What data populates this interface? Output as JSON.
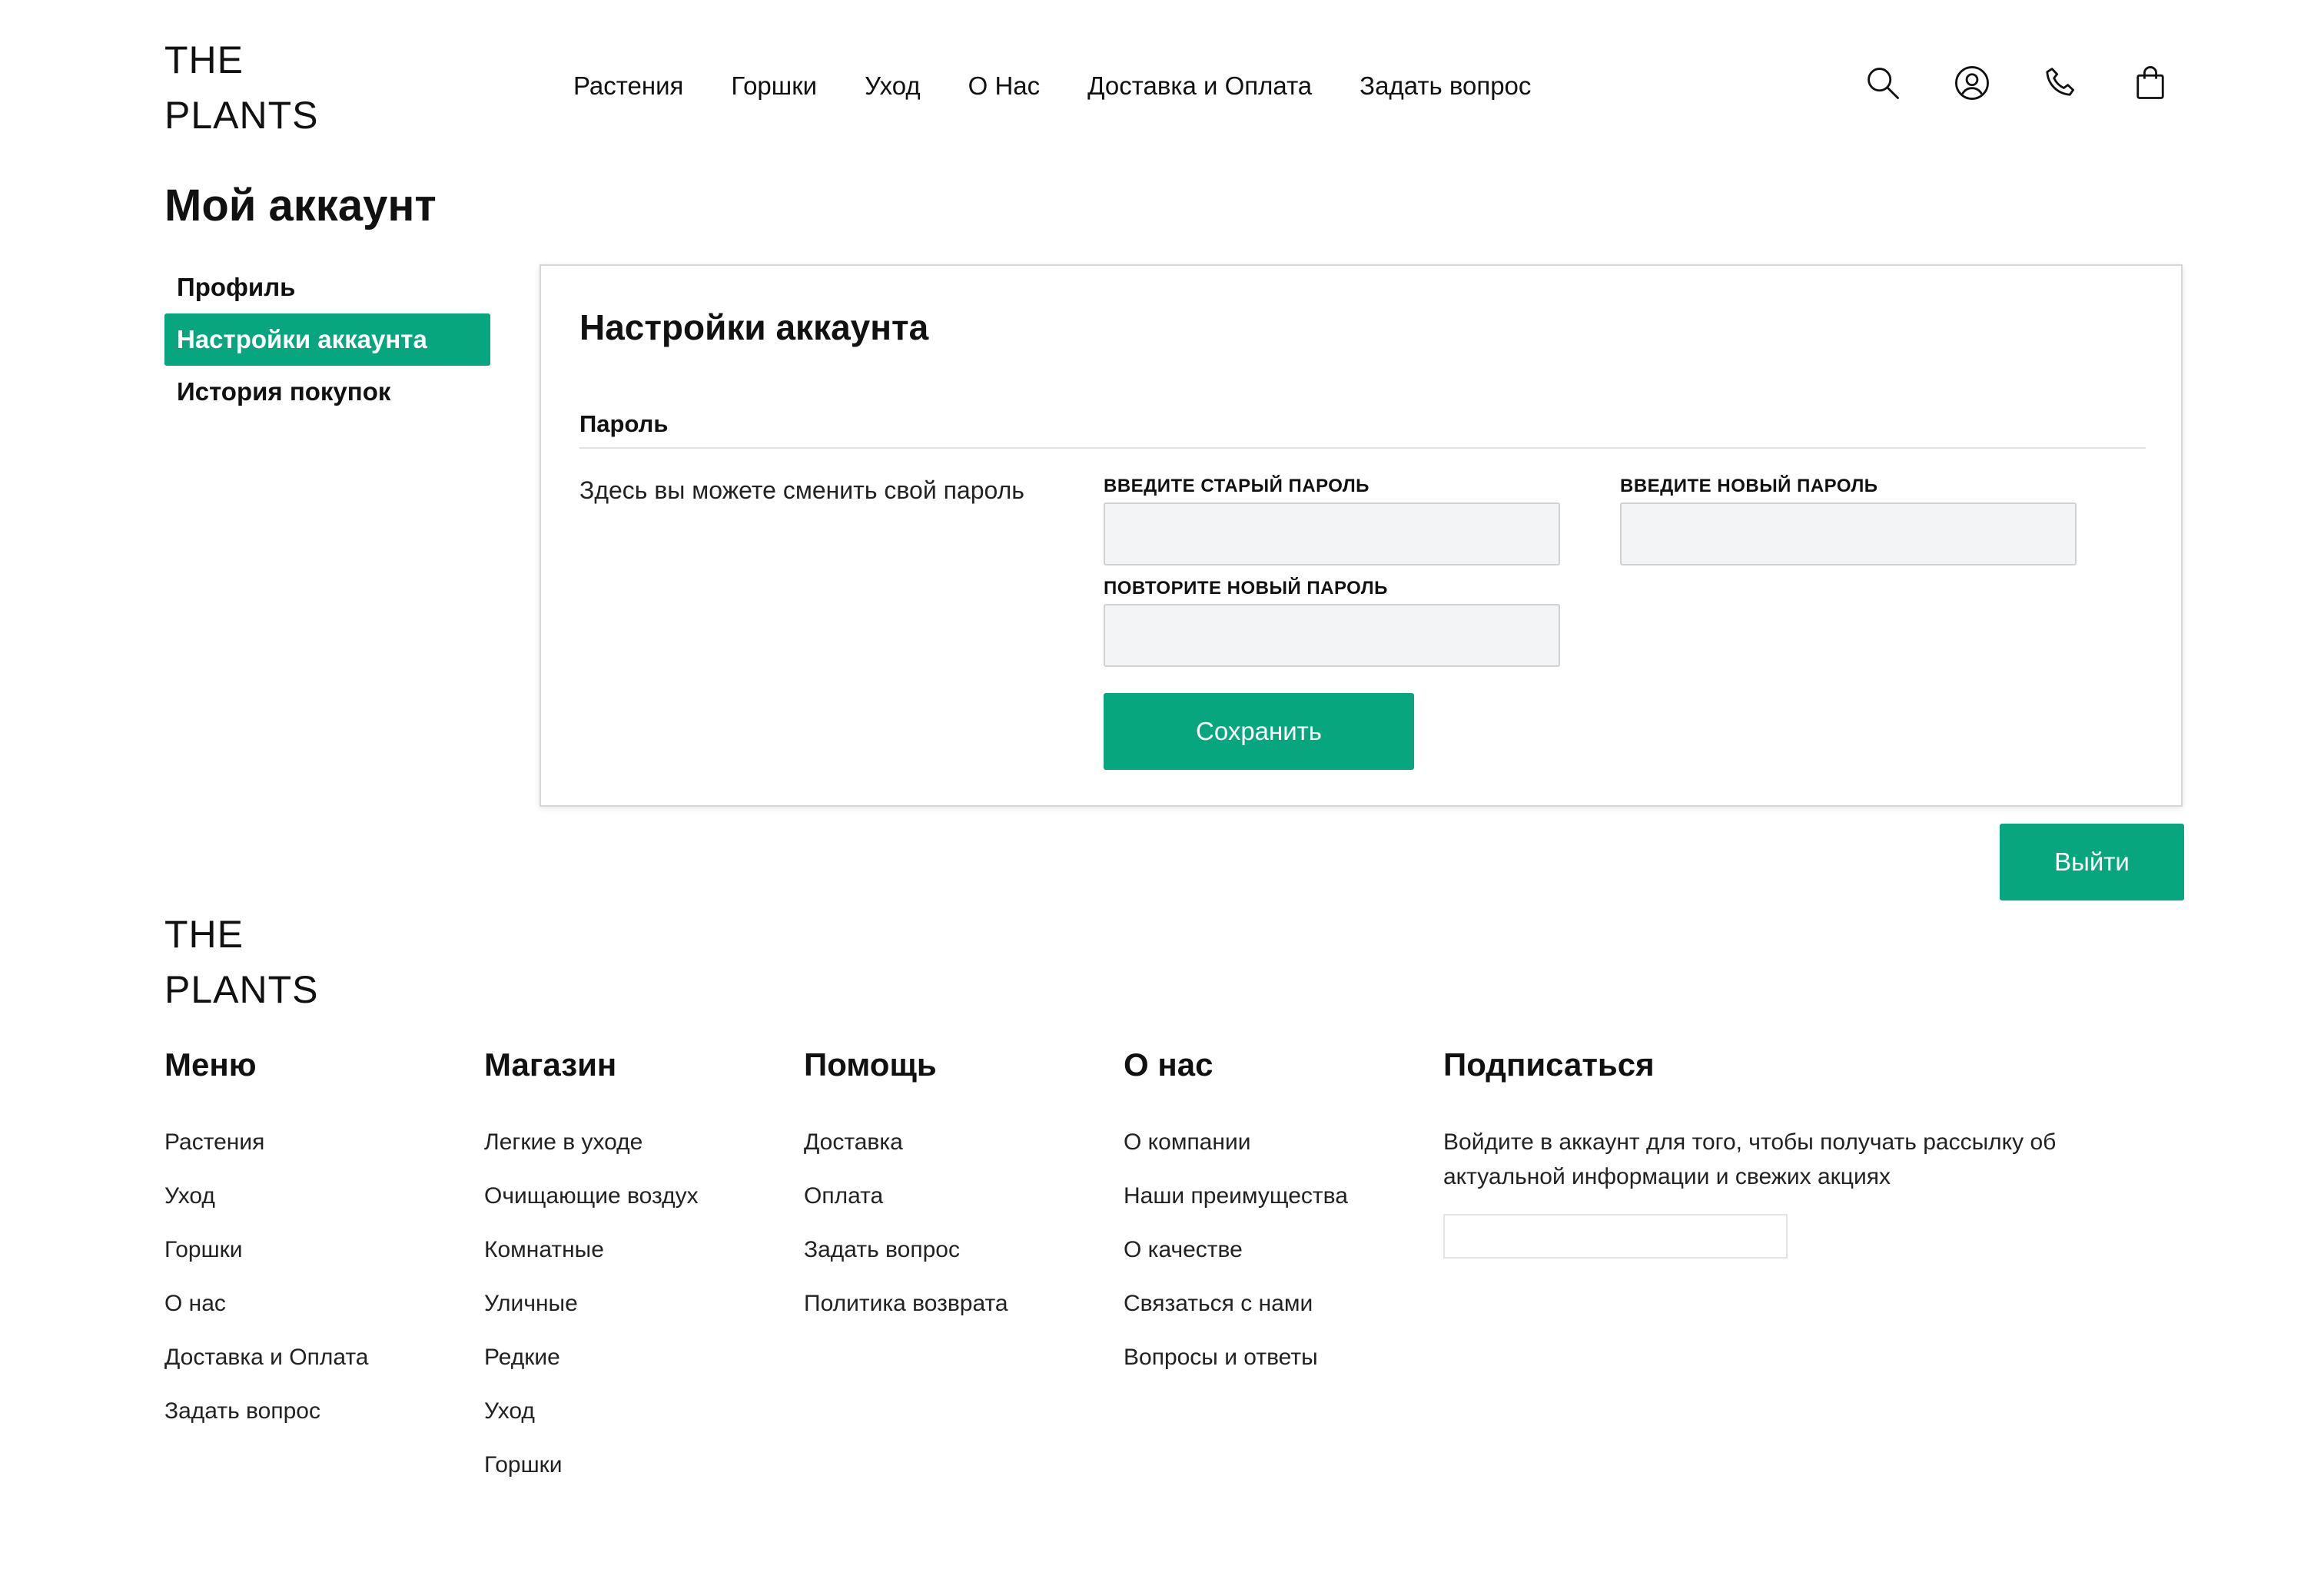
{
  "brand": {
    "line1": "THE",
    "line2": "PLANTS"
  },
  "nav": [
    {
      "label": "Растения"
    },
    {
      "label": "Горшки"
    },
    {
      "label": "Уход"
    },
    {
      "label": "О Нас"
    },
    {
      "label": "Доставка и Оплата"
    },
    {
      "label": "Задать вопрос"
    }
  ],
  "header_icons": [
    "search-icon",
    "user-icon",
    "phone-icon",
    "shopping-bag-icon"
  ],
  "page_title": "Мой аккаунт",
  "side_menu": [
    {
      "label": "Профиль",
      "active": false
    },
    {
      "label": "Настройки аккаунта",
      "active": true
    },
    {
      "label": "История покупок",
      "active": false
    }
  ],
  "settings": {
    "title": "Настройки аккаунта",
    "section_title": "Пароль",
    "description": "Здесь вы можете сменить свой пароль",
    "old_password": {
      "label": "Введите старый пароль",
      "value": ""
    },
    "new_password": {
      "label": "Введите новый пароль",
      "value": ""
    },
    "repeat_password": {
      "label": "Повторите новый пароль",
      "value": ""
    },
    "save_label": "Сохранить"
  },
  "logout_label": "Выйти",
  "footer": {
    "brand": {
      "line1": "THE",
      "line2": "PLANTS"
    },
    "columns": [
      {
        "title": "Меню",
        "links": [
          "Растения",
          "Уход",
          "Горшки",
          "О нас",
          "Доставка и Оплата",
          "Задать вопрос"
        ]
      },
      {
        "title": "Магазин",
        "links": [
          "Легкие в уходе",
          "Очищающие воздух",
          "Комнатные",
          "Уличные",
          "Редкие",
          "Уход",
          "Горшки"
        ]
      },
      {
        "title": "Помощь",
        "links": [
          "Доставка",
          "Оплата",
          "Задать вопрос",
          "Политика возврата"
        ]
      },
      {
        "title": "О нас",
        "links": [
          "О компании",
          "Наши преимущества",
          "О качестве",
          "Связаться с нами",
          "Вопросы и ответы"
        ]
      }
    ],
    "subscribe": {
      "title": "Подписаться",
      "text": "Войдите в аккаунт для того, чтобы получать рассылку об актуальной информации и свежих акциях",
      "input_value": ""
    }
  },
  "colors": {
    "accent": "#08a67e",
    "text": "#111111",
    "input_bg": "#f3f4f6",
    "border": "#d6d6d6"
  }
}
